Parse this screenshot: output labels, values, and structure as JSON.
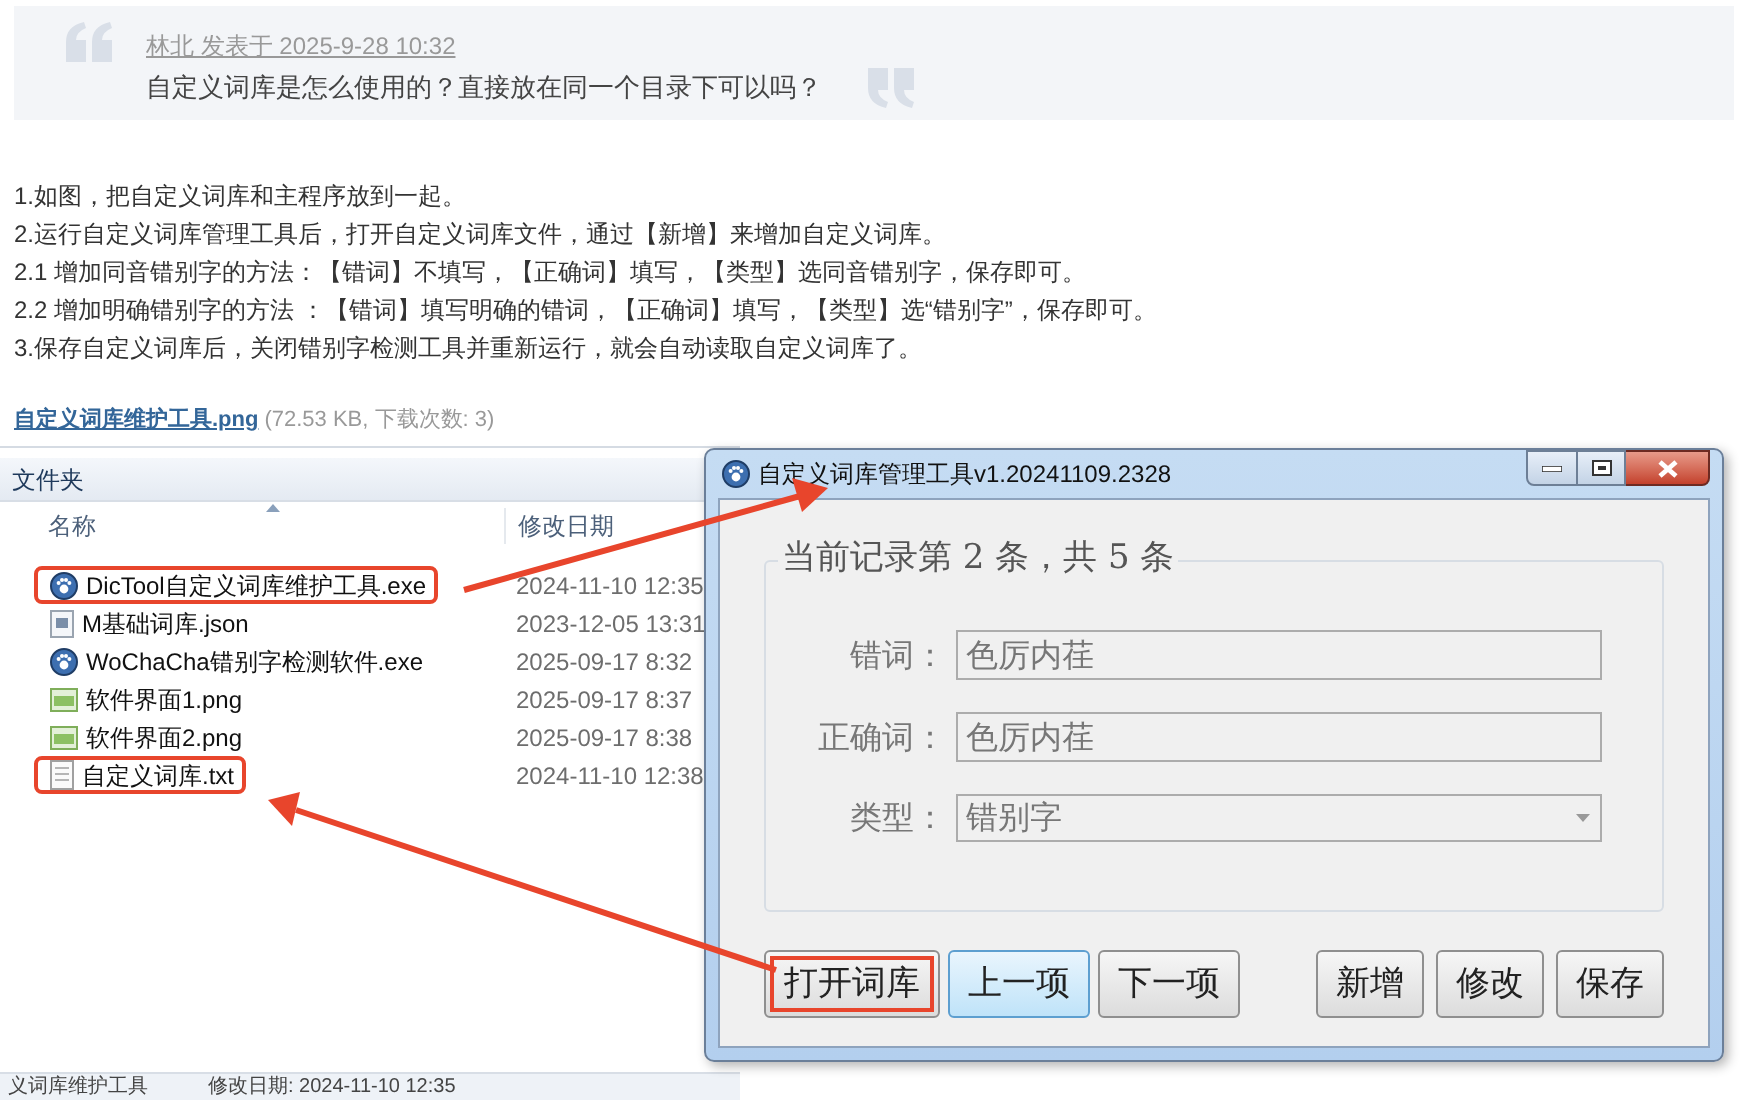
{
  "quote": {
    "author_line": "林北 发表于 2025-9-28 10:32",
    "text": "自定义词库是怎么使用的？直接放在同一个目录下可以吗？"
  },
  "post_lines": [
    "1.如图，把自定义词库和主程序放到一起。",
    "2.运行自定义词库管理工具后，打开自定义词库文件，通过【新增】来增加自定义词库。",
    "2.1  增加同音错别字的方法：【错词】不填写，【正确词】填写，【类型】选同音错别字，保存即可。",
    "2.2  增加明确错别字的方法 ：【错词】填写明确的错词，【正确词】填写，【类型】选“错别字”，保存即可。",
    "3.保存自定义词库后，关闭错别字检测工具并重新运行，就会自动读取自定义词库了。"
  ],
  "attachment": {
    "name": "自定义词库维护工具.png",
    "meta": "(72.53 KB, 下载次数: 3)"
  },
  "explorer": {
    "header": "文件夹",
    "columns": [
      "名称",
      "修改日期"
    ],
    "rows": [
      {
        "kind": "exe",
        "name": "DicTool自定义词库维护工具.exe",
        "date": "2024-11-10 12:35",
        "highlighted": true
      },
      {
        "kind": "json",
        "name": "M基础词库.json",
        "date": "2023-12-05 13:31",
        "highlighted": false
      },
      {
        "kind": "exe",
        "name": "WoChaCha错别字检测软件.exe",
        "date": "2025-09-17 8:32",
        "highlighted": false
      },
      {
        "kind": "png",
        "name": "软件界面1.png",
        "date": "2025-09-17 8:37",
        "highlighted": false
      },
      {
        "kind": "png",
        "name": "软件界面2.png",
        "date": "2025-09-17 8:38",
        "highlighted": false
      },
      {
        "kind": "txt",
        "name": "自定义词库.txt",
        "date": "2024-11-10 12:38",
        "highlighted": true
      }
    ],
    "details_bar": [
      "义词库维护工具",
      "修改日期: 2024-11-10 12:35"
    ]
  },
  "dialog": {
    "title": "自定义词库管理工具v1.20241109.2328",
    "legend": "当前记录第 2 条，共 5 条",
    "fields": [
      {
        "kind": "text",
        "label": "错词：",
        "value": "色厉内荏"
      },
      {
        "kind": "text",
        "label": "正确词：",
        "value": "色厉内荏"
      },
      {
        "kind": "select",
        "label": "类型：",
        "value": "错别字"
      }
    ],
    "nav_buttons": [
      {
        "label": "打开词库",
        "selected": false,
        "highlighted": true
      },
      {
        "label": "上一项",
        "selected": true,
        "highlighted": false
      },
      {
        "label": "下一项",
        "selected": false,
        "highlighted": false
      }
    ],
    "action_buttons": [
      {
        "label": "新增",
        "selected": false,
        "highlighted": false
      },
      {
        "label": "修改",
        "selected": false,
        "highlighted": false
      },
      {
        "label": "保存",
        "selected": false,
        "highlighted": false
      }
    ]
  }
}
